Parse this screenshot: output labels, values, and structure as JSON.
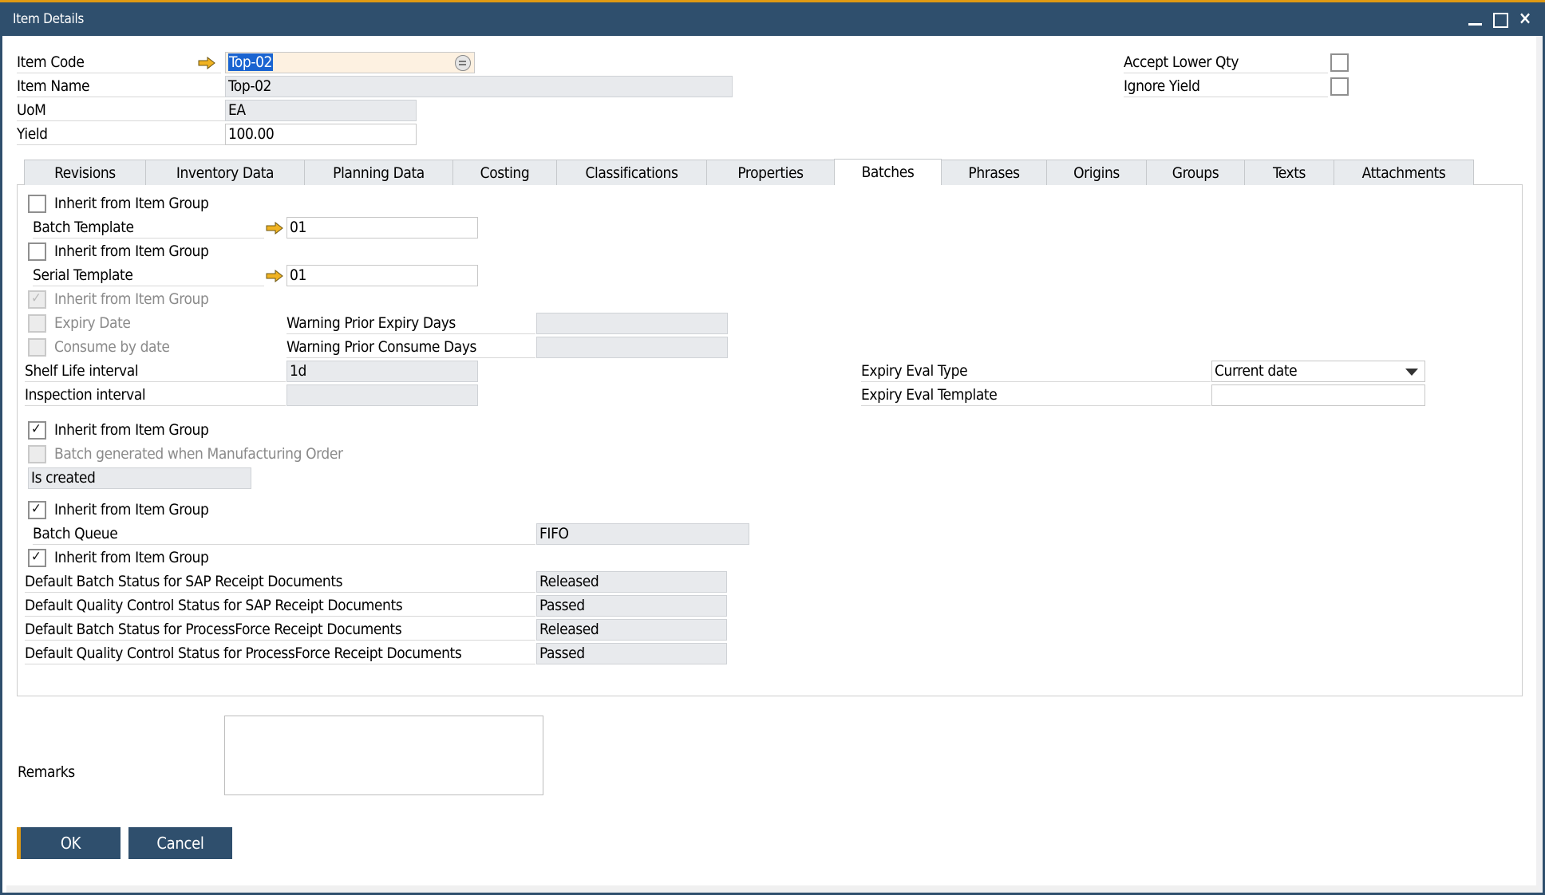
{
  "window": {
    "title": "Item Details",
    "controls": {
      "minimize": "minimize",
      "maximize": "maximize",
      "close": "×"
    },
    "accent_color": "#e09a12",
    "titlebar_color": "#2f4f6d"
  },
  "header": {
    "item_code": {
      "label": "Item Code",
      "value": "Top-02"
    },
    "item_name": {
      "label": "Item Name",
      "value": "Top-02"
    },
    "uom": {
      "label": "UoM",
      "value": "EA"
    },
    "yield": {
      "label": "Yield",
      "value": "100.00"
    },
    "accept_lower_qty": {
      "label": "Accept Lower Qty",
      "checked": false
    },
    "ignore_yield": {
      "label": "Ignore Yield",
      "checked": false
    }
  },
  "tabs": [
    {
      "label": "Revisions",
      "active": false
    },
    {
      "label": "Inventory Data",
      "active": false
    },
    {
      "label": "Planning Data",
      "active": false
    },
    {
      "label": "Costing",
      "active": false
    },
    {
      "label": "Classifications",
      "active": false
    },
    {
      "label": "Properties",
      "active": false
    },
    {
      "label": "Batches",
      "active": true
    },
    {
      "label": "Phrases",
      "active": false
    },
    {
      "label": "Origins",
      "active": false
    },
    {
      "label": "Groups",
      "active": false
    },
    {
      "label": "Texts",
      "active": false
    },
    {
      "label": "Attachments",
      "active": false
    }
  ],
  "batches": {
    "inherit_label": "Inherit from Item Group",
    "batch_template": {
      "inherit_checked": false,
      "label": "Batch Template",
      "value": "01"
    },
    "serial_template": {
      "inherit_checked": false,
      "label": "Serial Template",
      "value": "01"
    },
    "expiry": {
      "inherit_checked": true,
      "expiry_date": {
        "label": "Expiry Date",
        "checked": false
      },
      "consume_by_date": {
        "label": "Consume by date",
        "checked": false
      },
      "warning_expiry_days": {
        "label": "Warning Prior Expiry Days",
        "value": ""
      },
      "warning_consume_days": {
        "label": "Warning Prior Consume Days",
        "value": ""
      },
      "shelf_life": {
        "label": "Shelf Life interval",
        "value": "1d"
      },
      "inspection": {
        "label": "Inspection interval",
        "value": ""
      },
      "eval_type": {
        "label": "Expiry Eval Type",
        "value": "Current date"
      },
      "eval_template": {
        "label": "Expiry Eval Template",
        "value": ""
      }
    },
    "manufacturing": {
      "inherit_checked": true,
      "batch_generated_label": "Batch generated when Manufacturing Order",
      "batch_generated_checked": false,
      "when_value": "Is created"
    },
    "queue": {
      "inherit_checked": true,
      "label": "Batch Queue",
      "value": "FIFO"
    },
    "statuses": {
      "inherit_checked": true,
      "rows": [
        {
          "label": "Default Batch Status for SAP Receipt Documents",
          "value": "Released"
        },
        {
          "label": "Default Quality Control Status for SAP Receipt Documents",
          "value": "Passed"
        },
        {
          "label": "Default Batch Status for ProcessForce Receipt Documents",
          "value": "Released"
        },
        {
          "label": "Default Quality Control Status for ProcessForce Receipt Documents",
          "value": "Passed"
        }
      ]
    }
  },
  "remarks": {
    "label": "Remarks",
    "value": ""
  },
  "buttons": {
    "ok": "OK",
    "cancel": "Cancel"
  }
}
